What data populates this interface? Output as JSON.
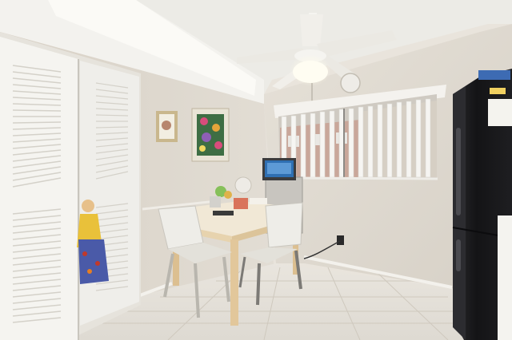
{
  "scene": {
    "description_type": "interior-photo",
    "colors": {
      "ceiling": "#ecebe6",
      "wall": "#dcd6cc",
      "floor": "#e8e4dc",
      "closet": "#f3f2ee",
      "table_top": "#f1e8d6",
      "table_leg": "#e2c79b",
      "chair": "#ecebe6",
      "fridge": "#1d1d1f",
      "window_glass": "#d9d9d6",
      "blinds": "#f4f4f2",
      "frame_art": "#5f8e57",
      "laptop_screen": "#2f6fb2"
    }
  }
}
